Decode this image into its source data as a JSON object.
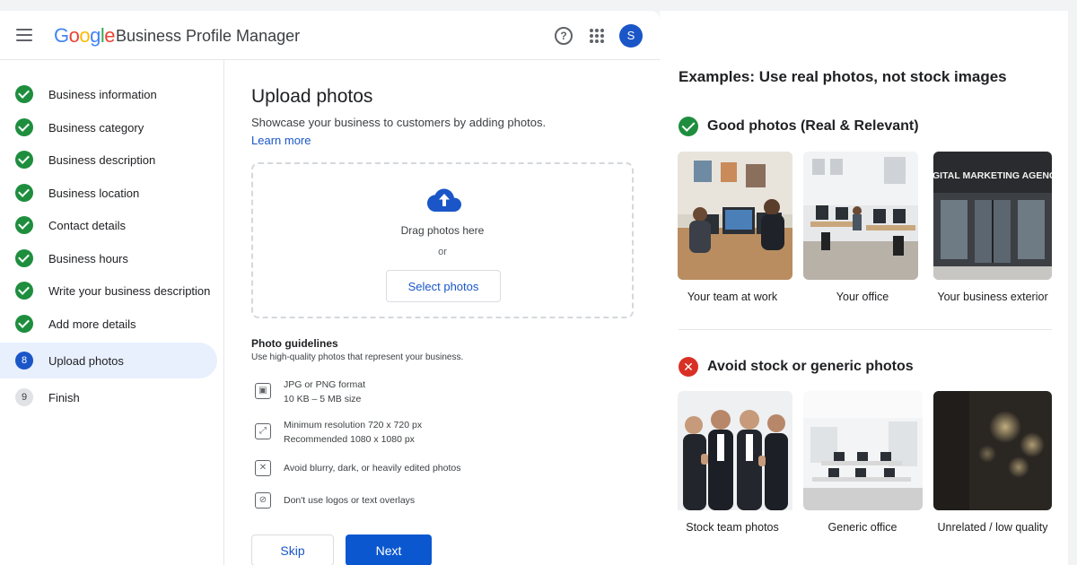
{
  "header": {
    "logo_letters": [
      "G",
      "o",
      "o",
      "g",
      "l",
      "e"
    ],
    "product_name": "Business Profile Manager",
    "help_glyph": "?",
    "avatar_initial": "S"
  },
  "sidebar": {
    "steps": [
      {
        "label": "Business information",
        "state": "done"
      },
      {
        "label": "Business category",
        "state": "done"
      },
      {
        "label": "Business description",
        "state": "done"
      },
      {
        "label": "Business location",
        "state": "done"
      },
      {
        "label": "Contact details",
        "state": "done"
      },
      {
        "label": "Business hours",
        "state": "done"
      },
      {
        "label": "Write your business description",
        "state": "done"
      },
      {
        "label": "Add more details",
        "state": "done"
      },
      {
        "label": "Upload photos",
        "state": "current",
        "number": "8"
      },
      {
        "label": "Finish",
        "state": "todo",
        "number": "9"
      }
    ]
  },
  "main": {
    "title": "Upload photos",
    "subtitle": "Showcase your business to customers by adding photos.",
    "learn_more": "Learn more",
    "dropzone": {
      "drag_text": "Drag photos here",
      "or_text": "or",
      "select_label": "Select photos"
    },
    "guidelines": {
      "title": "Photo guidelines",
      "subtitle": "Use high-quality photos that represent your business.",
      "items": [
        {
          "line1": "JPG or PNG format",
          "line2": "10 KB – 5 MB size",
          "icon": "image-file-icon"
        },
        {
          "line1": "Minimum resolution 720 x 720 px",
          "line2": "Recommended 1080 x 1080 px",
          "icon": "resize-icon"
        },
        {
          "line1": "Avoid blurry, dark, or heavily edited photos",
          "line2": "",
          "icon": "blur-warning-icon"
        },
        {
          "line1": "Don't use logos or text overlays",
          "line2": "",
          "icon": "no-logo-icon"
        }
      ]
    },
    "skip_label": "Skip",
    "next_label": "Next"
  },
  "examples": {
    "title": "Examples: Use real photos, not stock images",
    "good": {
      "heading": "Good photos (Real & Relevant)",
      "photos": [
        {
          "caption": "Your team at work"
        },
        {
          "caption": "Your office"
        },
        {
          "caption": "Your business exterior",
          "sign_text": "DIGITAL MARKETING AGENCY"
        }
      ]
    },
    "bad": {
      "heading": "Avoid stock or generic photos",
      "icon_glyph": "✕",
      "photos": [
        {
          "caption": "Stock team photos"
        },
        {
          "caption": "Generic office"
        },
        {
          "caption": "Unrelated / low quality"
        }
      ]
    }
  },
  "colors": {
    "primary_blue": "#0b57d0",
    "success_green": "#1e8e3e",
    "error_red": "#d93025",
    "active_step_bg": "#e8f0fe"
  }
}
